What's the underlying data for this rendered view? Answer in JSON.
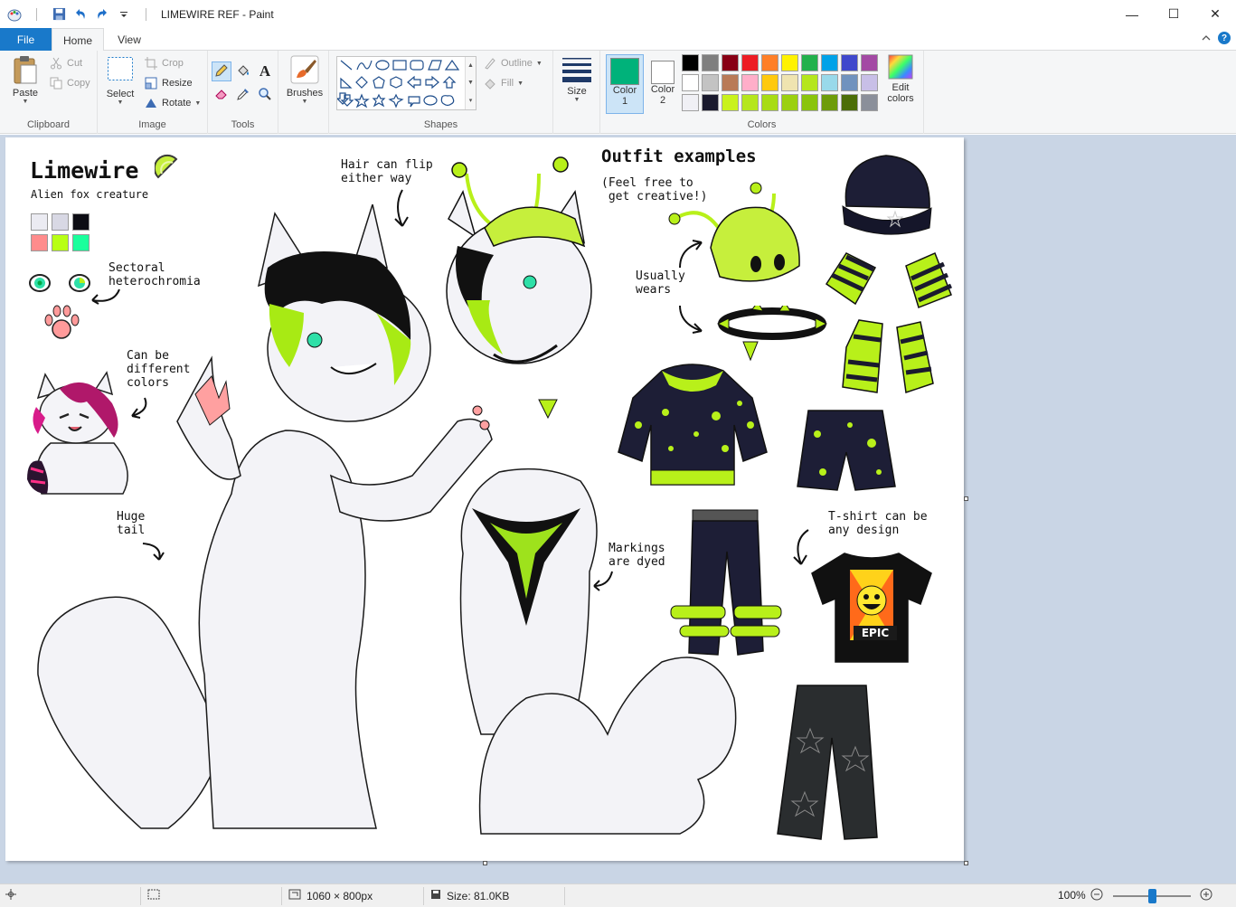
{
  "window": {
    "title": "LIMEWIRE REF - Paint",
    "controls": {
      "minimize": "—",
      "maximize": "☐",
      "close": "✕"
    }
  },
  "ribbon_tabs": {
    "file": "File",
    "home": "Home",
    "view": "View"
  },
  "ribbon": {
    "clipboard": {
      "label": "Clipboard",
      "paste": "Paste",
      "cut": "Cut",
      "copy": "Copy"
    },
    "image": {
      "label": "Image",
      "select": "Select",
      "crop": "Crop",
      "resize": "Resize",
      "rotate": "Rotate"
    },
    "tools": {
      "label": "Tools"
    },
    "brushes": {
      "label": "Brushes"
    },
    "shapes": {
      "label": "Shapes",
      "outline": "Outline",
      "fill": "Fill"
    },
    "size": {
      "label": "Size"
    },
    "colors": {
      "label": "Colors",
      "color1_label": "Color",
      "color1_num": "1",
      "color2_label": "Color",
      "color2_num": "2",
      "color1": "#00b27a",
      "color2": "#ffffff",
      "edit_line1": "Edit",
      "edit_line2": "colors",
      "palette_row1": [
        "#000000",
        "#7f7f7f",
        "#880015",
        "#ed1c24",
        "#ff7f27",
        "#fff200",
        "#22b14c",
        "#00a2e8",
        "#3f48cc",
        "#a349a4"
      ],
      "palette_row2": [
        "#ffffff",
        "#c3c3c3",
        "#b97a57",
        "#ffaec9",
        "#ffc90e",
        "#efe4b0",
        "#b5e61d",
        "#99d9ea",
        "#7092be",
        "#c8bfe7"
      ],
      "palette_row3": [
        "#f0f0f5",
        "#1a1a2e",
        "#c9f21d",
        "#b5e61d",
        "#a8dc14",
        "#9bd010",
        "#8ac40c",
        "#6e9c0a",
        "#4c6e08",
        "#8a8f9a"
      ]
    }
  },
  "canvas_art": {
    "title": "Limewire",
    "subtitle": "Alien fox creature",
    "ref_palette": [
      "#ebebf2",
      "#d8d8e4",
      "#0d0d14",
      "#ff8c8c",
      "#b8ff14",
      "#1aff9c"
    ],
    "labels": {
      "hair": "Hair can flip\neither way",
      "outfit_title": "Outfit examples",
      "outfit_sub": "(Feel free to\n get creative!)",
      "sectoral": "Sectoral\nheterochromia",
      "usually": "Usually\nwears",
      "can_be_1": "Can be",
      "different": "different",
      "can_be_3": "colors",
      "huge_tail": "Huge\ntail",
      "markings": "Markings\nare dyed",
      "tshirt": "T-shirt can be\nany design",
      "epic": "EPIC"
    }
  },
  "statusbar": {
    "dimensions": "1060 × 800px",
    "size": "Size: 81.0KB",
    "zoom": "100%",
    "zoom_fraction": 0.5
  }
}
